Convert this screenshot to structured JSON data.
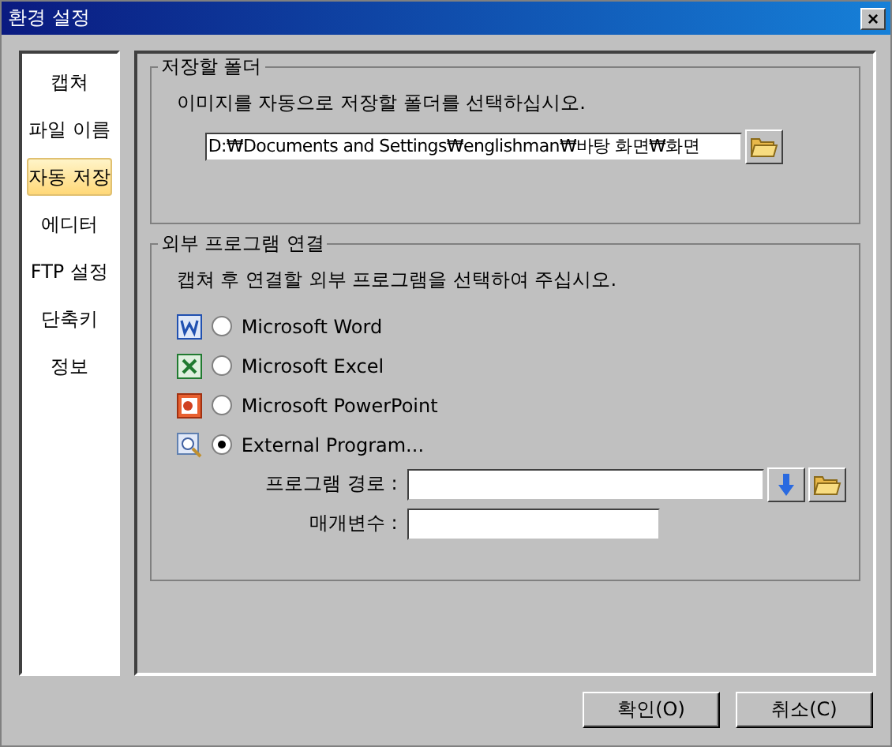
{
  "window": {
    "title": "환경 설정",
    "close": "×"
  },
  "sidebar": {
    "items": [
      {
        "label": "캡쳐",
        "selected": false
      },
      {
        "label": "파일 이름",
        "selected": false
      },
      {
        "label": "자동 저장",
        "selected": true
      },
      {
        "label": "에디터",
        "selected": false
      },
      {
        "label": "FTP 설정",
        "selected": false
      },
      {
        "label": "단축키",
        "selected": false
      },
      {
        "label": "정보",
        "selected": false
      }
    ]
  },
  "save_folder": {
    "legend": "저장할 폴더",
    "description": "이미지를 자동으로 저장할 폴더를 선택하십시오.",
    "path": "D:₩Documents and Settings₩englishman₩바탕 화면₩화면"
  },
  "external_program": {
    "legend": "외부 프로그램 연결",
    "description": "캡쳐 후 연결할 외부 프로그램을 선택하여 주십시오.",
    "options": [
      {
        "kind": "word",
        "label": "Microsoft Word",
        "selected": false
      },
      {
        "kind": "excel",
        "label": "Microsoft Excel",
        "selected": false
      },
      {
        "kind": "powerpoint",
        "label": "Microsoft PowerPoint",
        "selected": false
      },
      {
        "kind": "external",
        "label": "External Program...",
        "selected": true
      }
    ],
    "path_label": "프로그램 경로 :",
    "params_label": "매개변수 :"
  },
  "buttons": [
    "확인(O)",
    "취소(C)"
  ]
}
